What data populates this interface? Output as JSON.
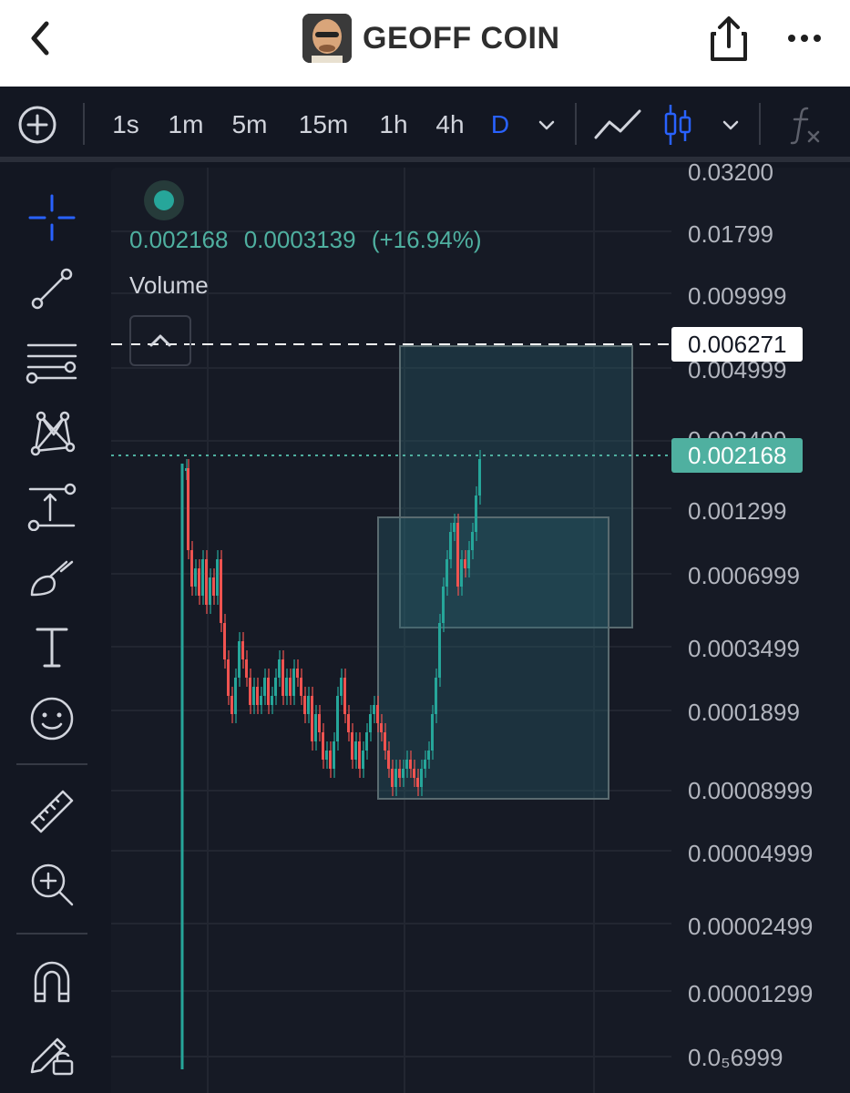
{
  "header": {
    "title": "GEOFF COIN",
    "back_icon": "chevron-left-icon",
    "share_icon": "share-icon",
    "more_icon": "more-horizontal-icon"
  },
  "toolbar": {
    "add_icon": "plus-circle-icon",
    "intervals": [
      "1s",
      "1m",
      "5m",
      "15m",
      "1h",
      "4h",
      "D"
    ],
    "active_interval": "D",
    "chart_types": [
      "line-chart-icon",
      "candlestick-icon"
    ],
    "indicators_icon": "fx-icon"
  },
  "sidebar": {
    "tools": [
      "crosshair-icon",
      "trend-line-icon",
      "fib-levels-icon",
      "pattern-icon",
      "measure-icon",
      "brush-icon",
      "text-icon",
      "emoji-icon",
      "ruler-icon",
      "zoom-in-icon",
      "magnet-icon",
      "lock-drawings-icon"
    ]
  },
  "chart": {
    "legend": {
      "price": "0.002168",
      "change": "0.0003139",
      "change_pct": "(+16.94%)"
    },
    "volume_label": "Volume",
    "price_scale": [
      "0.03200",
      "0.01799",
      "0.009999",
      "0.004999",
      "0.002499",
      "0.001299",
      "0.0006999",
      "0.0003499",
      "0.0001899",
      "0.00008999",
      "0.00004999",
      "0.00002499",
      "0.00001299",
      "0.0₅6999"
    ],
    "dashed_line_price": "0.006271",
    "last_price": "0.002168",
    "colors": {
      "up": "#26a69a",
      "down": "#ef5350",
      "accent": "#2962ff",
      "background": "#161a25"
    }
  }
}
